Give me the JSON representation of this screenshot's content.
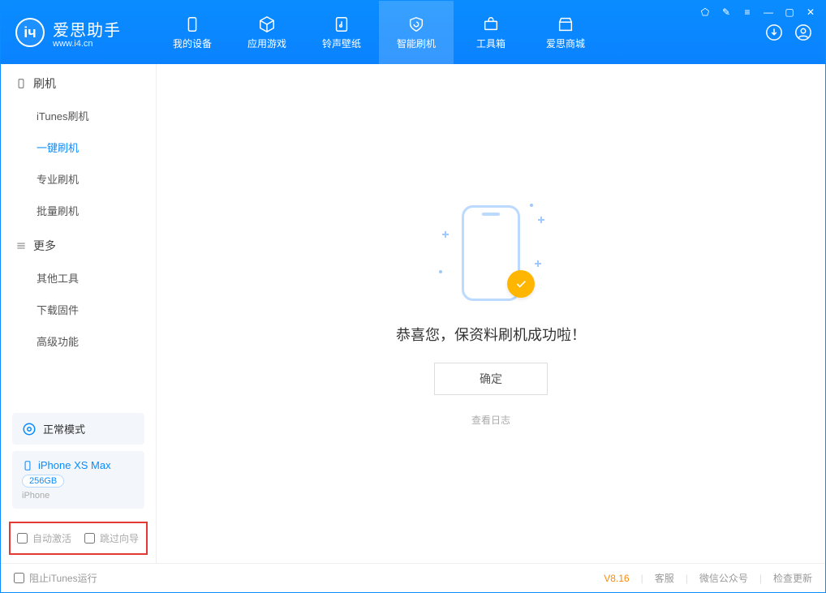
{
  "brand": {
    "name": "爱思助手",
    "url": "www.i4.cn"
  },
  "tabs": [
    {
      "label": "我的设备"
    },
    {
      "label": "应用游戏"
    },
    {
      "label": "铃声壁纸"
    },
    {
      "label": "智能刷机"
    },
    {
      "label": "工具箱"
    },
    {
      "label": "爱思商城"
    }
  ],
  "sidebar": {
    "section1": {
      "title": "刷机",
      "items": [
        "iTunes刷机",
        "一键刷机",
        "专业刷机",
        "批量刷机"
      ]
    },
    "section2": {
      "title": "更多",
      "items": [
        "其他工具",
        "下载固件",
        "高级功能"
      ]
    }
  },
  "mode": {
    "label": "正常模式"
  },
  "device": {
    "name": "iPhone XS Max",
    "capacity": "256GB",
    "type": "iPhone"
  },
  "options": {
    "auto_activate": "自动激活",
    "skip_guide": "跳过向导"
  },
  "main": {
    "message": "恭喜您，保资料刷机成功啦！",
    "ok": "确定",
    "view_log": "查看日志"
  },
  "footer": {
    "block_itunes": "阻止iTunes运行",
    "version": "V8.16",
    "support": "客服",
    "wechat": "微信公众号",
    "check_update": "检查更新"
  }
}
